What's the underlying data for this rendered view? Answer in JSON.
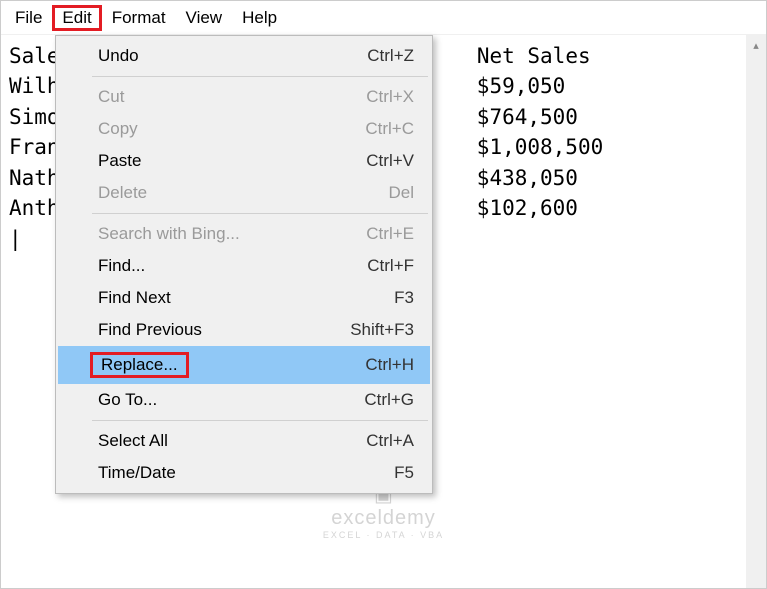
{
  "menubar": {
    "items": [
      "File",
      "Edit",
      "Format",
      "View",
      "Help"
    ],
    "highlighted_index": 1
  },
  "content": {
    "col_header_right": "Net Sales",
    "rows": [
      {
        "left": "Sale",
        "right": "Net Sales"
      },
      {
        "left": "Wilh",
        "right": "59,050"
      },
      {
        "left": "Simo",
        "right": "764,500"
      },
      {
        "left": "Fran",
        "right": "1,008,500"
      },
      {
        "left": "Nath",
        "right": "438,050"
      },
      {
        "left": "Anth",
        "right": "102,600"
      }
    ]
  },
  "dropdown": {
    "groups": [
      [
        {
          "label": "Undo",
          "shortcut": "Ctrl+Z",
          "disabled": false
        }
      ],
      [
        {
          "label": "Cut",
          "shortcut": "Ctrl+X",
          "disabled": true
        },
        {
          "label": "Copy",
          "shortcut": "Ctrl+C",
          "disabled": true
        },
        {
          "label": "Paste",
          "shortcut": "Ctrl+V",
          "disabled": false
        },
        {
          "label": "Delete",
          "shortcut": "Del",
          "disabled": true
        }
      ],
      [
        {
          "label": "Search with Bing...",
          "shortcut": "Ctrl+E",
          "disabled": true
        },
        {
          "label": "Find...",
          "shortcut": "Ctrl+F",
          "disabled": false
        },
        {
          "label": "Find Next",
          "shortcut": "F3",
          "disabled": false
        },
        {
          "label": "Find Previous",
          "shortcut": "Shift+F3",
          "disabled": false
        },
        {
          "label": "Replace...",
          "shortcut": "Ctrl+H",
          "disabled": false,
          "highlighted": true,
          "redbox": true
        },
        {
          "label": "Go To...",
          "shortcut": "Ctrl+G",
          "disabled": false
        }
      ],
      [
        {
          "label": "Select All",
          "shortcut": "Ctrl+A",
          "disabled": false
        },
        {
          "label": "Time/Date",
          "shortcut": "F5",
          "disabled": false
        }
      ]
    ]
  },
  "watermark": {
    "main": "exceldemy",
    "sub": "EXCEL · DATA · VBA"
  }
}
